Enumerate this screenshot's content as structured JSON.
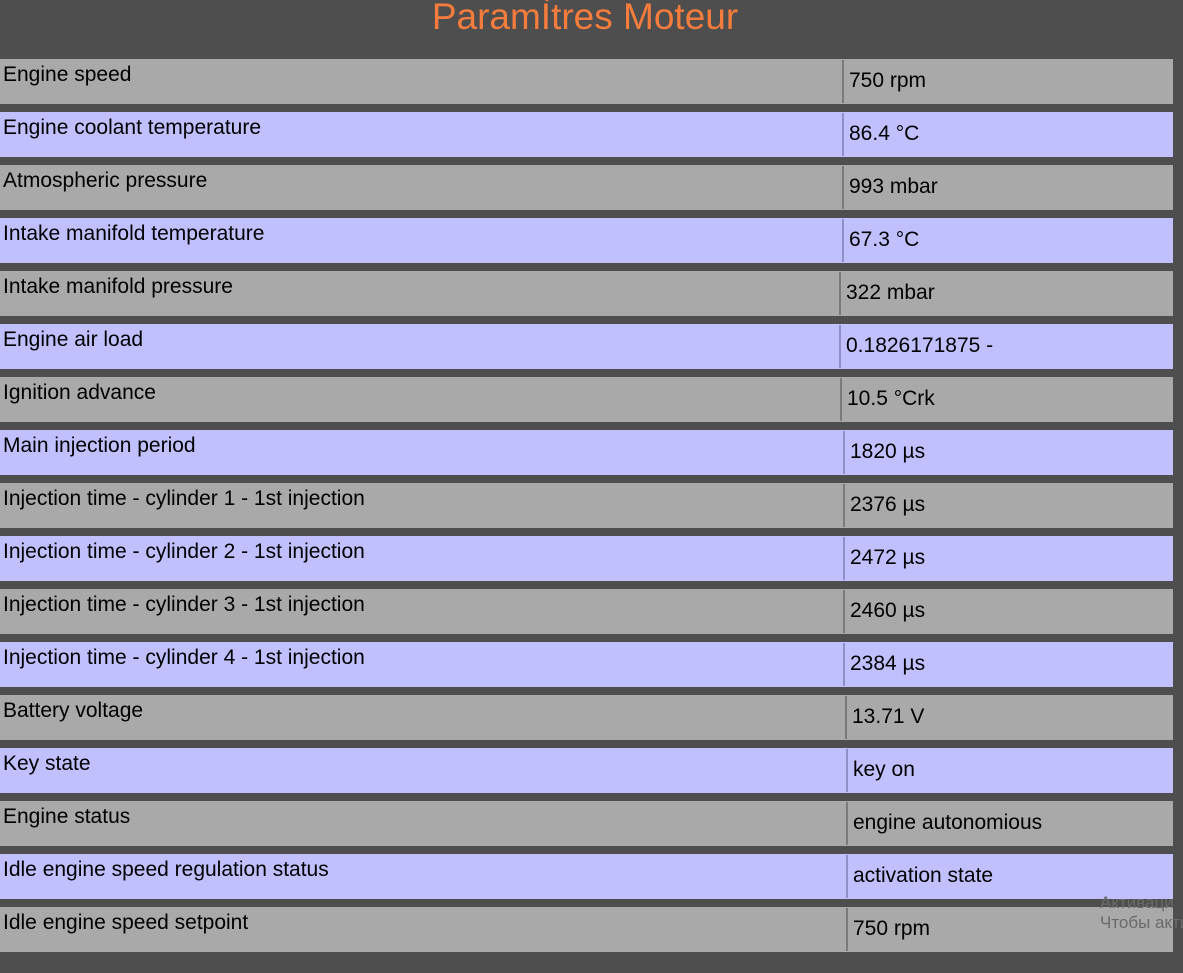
{
  "title": "ParamÌtres Moteur",
  "colors": {
    "title": "#f47c3c",
    "background": "#4e4e4e",
    "row_gray": "#a9a9a9",
    "row_blue": "#c0c0ff"
  },
  "rows": [
    {
      "label": "Engine speed",
      "value": "750 rpm"
    },
    {
      "label": "Engine coolant temperature",
      "value": "86.4 °C"
    },
    {
      "label": "Atmospheric pressure",
      "value": "993 mbar"
    },
    {
      "label": "Intake manifold temperature",
      "value": "67.3 °C"
    },
    {
      "label": "Intake manifold pressure",
      "value": "322 mbar"
    },
    {
      "label": "Engine air load",
      "value": "0.1826171875 -"
    },
    {
      "label": "Ignition advance",
      "value": "10.5 °Crk"
    },
    {
      "label": "Main injection period",
      "value": "1820 µs"
    },
    {
      "label": "Injection time - cylinder 1 - 1st injection",
      "value": "2376 µs"
    },
    {
      "label": "Injection time - cylinder 2 - 1st injection",
      "value": "2472 µs"
    },
    {
      "label": "Injection time - cylinder 3 - 1st injection",
      "value": "2460 µs"
    },
    {
      "label": "Injection time - cylinder 4 - 1st injection",
      "value": "2384 µs"
    },
    {
      "label": "Battery voltage",
      "value": "13.71 V"
    },
    {
      "label": "Key state",
      "value": "key on"
    },
    {
      "label": "Engine status",
      "value": "engine autonomious"
    },
    {
      "label": "Idle engine speed regulation status",
      "value": "activation state"
    },
    {
      "label": "Idle engine speed setpoint",
      "value": "750 rpm"
    }
  ],
  "watermark": {
    "line1": "Активаци",
    "line2": "Чтобы акти"
  }
}
